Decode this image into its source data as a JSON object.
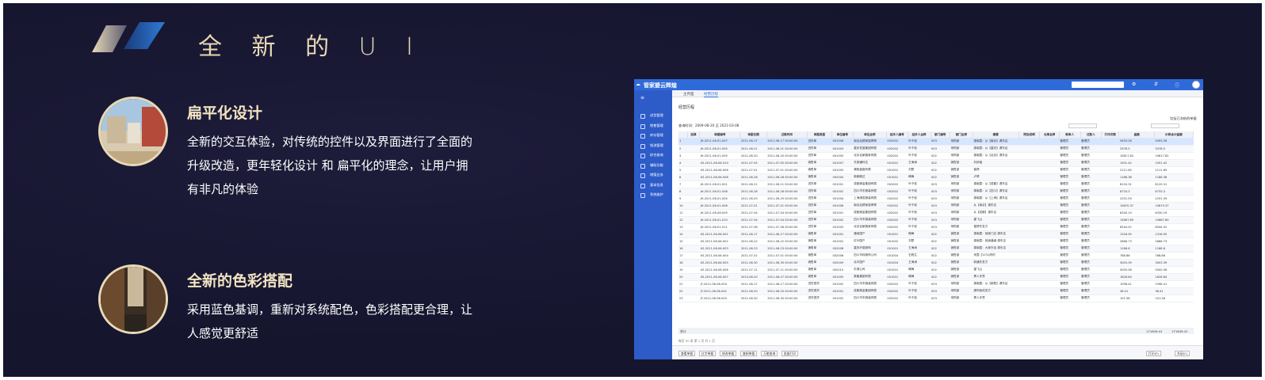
{
  "slide": {
    "title": "全 新 的 U I"
  },
  "features": [
    {
      "title": "扁平化设计",
      "desc": "全新的交互体验，对传统的控件以及界面进行了全面的升级改造，更年轻化设计 和 扁平化的理念，让用户拥有非凡的体验"
    },
    {
      "title": "全新的色彩搭配",
      "desc": "采用蓝色基调，重新对系统配色，色彩搭配更合理，让人感觉更舒适"
    }
  ],
  "app": {
    "brand": "管家婆云辉煌",
    "sidebar": [
      "进货管理",
      "销售管理",
      "库存管理",
      "钱流管理",
      "综合查询",
      "辅助功能",
      "增值业务",
      "基本信息",
      "系统维护"
    ],
    "tabs": [
      "主界面",
      "经营历程"
    ],
    "page_title": "经营历程",
    "filter_label": "查询时间：2009-08-20 至 2021-03-08",
    "check_label": "包括已冻结的单据",
    "columns": [
      "",
      "选择",
      "单据编号",
      "单据日期",
      "过账时间",
      "单据类型",
      "单位编号",
      "单位全称",
      "经手人编号",
      "经手人全称",
      "部门编号",
      "部门全称",
      "摘要",
      "附加说明",
      "仓库全称",
      "制单人",
      "过账人",
      "打印次数",
      "金额",
      "价税合计金额"
    ],
    "rows": [
      [
        "1",
        "",
        "JH-2011-06-01-007",
        "2011-06-17",
        "2011-06-17 00:00:00",
        "进货单",
        "001006",
        "南京后顾家族哥哥",
        "002002",
        "叶子叔",
        "003",
        "采购部",
        "源南霞：从【南京】源东店",
        "",
        "",
        "管理员",
        "管理员",
        "",
        "5493.28",
        "5493.28"
      ],
      [
        "2",
        "",
        "JH-2011-06-01-005",
        "2011-06-21",
        "2011-06-21 00:00:00",
        "进货单",
        "001003",
        "重庆发蓝集团有限",
        "002002",
        "叶子叔",
        "003",
        "采购部",
        "源南霞：从【重庆】源东店",
        "",
        "",
        "管理员",
        "管理员",
        "",
        "3378.5",
        "3378.5"
      ],
      [
        "3",
        "",
        "JH-2011-06-01-005",
        "2011-06-20",
        "2011-06-20 00:00:00",
        "进货单",
        "001005",
        "北京百家路家有限",
        "002002",
        "叶子叔",
        "002",
        "采购部",
        "源南霞：从【北京】源东店",
        "",
        "",
        "管理员",
        "管理员",
        "",
        "10817.82",
        "10817.82"
      ],
      [
        "4",
        "",
        "XS-2011-06-06-010",
        "2011-07-05",
        "2011-07-05 00:00:00",
        "销售单",
        "001007",
        "东莞通利达",
        "001001",
        "王海涛",
        "002",
        "销售部",
        "刘伊涵",
        "",
        "",
        "管理员",
        "管理员",
        "",
        "1551.42",
        "1551.42"
      ],
      [
        "5",
        "",
        "XS-2011-06-06-006",
        "2011-07-01",
        "2011-07-01 00:00:00",
        "销售单",
        "001005",
        "满阳鑫鑫有限",
        "001002",
        "刘蒙",
        "002",
        "销售部",
        "曾婷",
        "",
        "",
        "管理员",
        "管理员",
        "",
        "2111.65",
        "2111.65"
      ],
      [
        "6",
        "",
        "XS-2011-06-06-008",
        "2011-06-28",
        "2011-06-28 00:00:00",
        "销售单",
        "002004",
        "新都朗达",
        "001001",
        "韩梅",
        "002",
        "销售部",
        "卢琴",
        "",
        "",
        "管理员",
        "管理员",
        "",
        "1186.38",
        "1186.38"
      ],
      [
        "7",
        "",
        "JH-2011-06-01-001",
        "2011-06-21",
        "2011-06-21 00:00:00",
        "进货单",
        "001001",
        "成都美金集团有限",
        "002002",
        "叶子叔",
        "003",
        "采购部",
        "源南霞：从【成都】源东店",
        "",
        "",
        "管理员",
        "管理员",
        "",
        "8120.31",
        "8120.31"
      ],
      [
        "8",
        "",
        "JH-2011-06-01-008",
        "2011-06-28",
        "2011-06-28 00:00:00",
        "进货单",
        "001002",
        "四川华东服装有限",
        "002002",
        "叶子叔",
        "003",
        "采购部",
        "源南霞：从【四川】源东店",
        "",
        "",
        "管理员",
        "管理员",
        "",
        "8733.3",
        "8733.3"
      ],
      [
        "9",
        "",
        "JH-2011-06-01-004",
        "2011-06-29",
        "2011-06-29 00:00:00",
        "进货单",
        "001004",
        "上海浦发服装有限",
        "002002",
        "叶子叔",
        "003",
        "采购部",
        "源南霞：从【上海】源东店",
        "",
        "",
        "管理员",
        "管理员",
        "",
        "2251.59",
        "2251.59"
      ],
      [
        "10",
        "",
        "JH-2011-06-01-006",
        "2011-07-01",
        "2011-07-01 00:00:00",
        "进货单",
        "001006",
        "南京后顾家族哥哥",
        "002002",
        "叶子叔",
        "003",
        "采购部",
        "从【南京】源东店",
        "",
        "",
        "管理员",
        "管理员",
        "",
        "10870.37",
        "10870.37"
      ],
      [
        "11",
        "",
        "JH-2011-06-06-009",
        "2011-07-04",
        "2011-07-04 00:00:00",
        "进货单",
        "001001",
        "成都美金集团有限",
        "002002",
        "叶子叔",
        "003",
        "采购部",
        "从【成都】源东店",
        "",
        "",
        "管理员",
        "管理员",
        "",
        "6330.19",
        "6330.19"
      ],
      [
        "12",
        "",
        "JH-2011-06-01-010",
        "2011-07-04",
        "2011-07-04 00:00:00",
        "进货单",
        "001002",
        "四川华东服装有限",
        "002002",
        "叶子叔",
        "003",
        "采购部",
        "重飞山",
        "",
        "",
        "管理员",
        "管理员",
        "",
        "15667.89",
        "15667.89"
      ],
      [
        "13",
        "",
        "JH-2011-06-01-011",
        "2011-07-06",
        "2011-07-06 00:00:00",
        "进货单",
        "001005",
        "北京百家路家有限",
        "002002",
        "叶子叔",
        "003",
        "采购部",
        "曾婷先发方",
        "",
        "",
        "管理员",
        "管理员",
        "",
        "8544.52",
        "8544.52"
      ],
      [
        "14",
        "",
        "XS-2011-06-06-001",
        "2011-06-17",
        "2011-06-17 00:00:00",
        "销售单",
        "001001",
        "通用国产",
        "001001",
        "韩梅",
        "002",
        "销售部",
        "源南霞：前面门店 源东店",
        "",
        "",
        "管理员",
        "管理员",
        "",
        "1316.95",
        "1316.95"
      ],
      [
        "15",
        "",
        "XS-2011-06-06-002",
        "2011-06-22",
        "2011-06-22 00:00:00",
        "销售单",
        "001002",
        "红叶国产",
        "001002",
        "刘蒙",
        "002",
        "销售部",
        "源南霞：前面通道 源东店",
        "",
        "",
        "管理员",
        "管理员",
        "",
        "2866.73",
        "2866.73"
      ],
      [
        "16",
        "",
        "XS-2011-06-06-003",
        "2011-06-23",
        "2011-06-23 00:00:00",
        "销售单",
        "002008",
        "重庆环夏服饰",
        "001001",
        "王海涛",
        "002",
        "销售部",
        "源南霞：大家外加 源东店",
        "",
        "",
        "管理员",
        "管理员",
        "",
        "1186.6",
        "1186.6"
      ],
      [
        "17",
        "",
        "XS-2011-06-06-004",
        "2011-07-01",
        "2011-07-01 00:00:00",
        "销售单",
        "002008",
        "四川华科服饰公司",
        "001004",
        "石现生",
        "002",
        "销售部",
        "来霞【12%)同时",
        "",
        "",
        "管理员",
        "管理员",
        "",
        "768.86",
        "768.86"
      ],
      [
        "18",
        "",
        "XS-2011-06-06-005",
        "2011-06-30",
        "2011-06-30 00:00:00",
        "销售单",
        "002009",
        "北中国产",
        "001004",
        "王海涛",
        "002",
        "销售部",
        "新通先发方",
        "",
        "",
        "管理员",
        "管理员",
        "",
        "3003.39",
        "3003.39"
      ],
      [
        "19",
        "",
        "XS-2011-06-06-006",
        "2011-07-11",
        "2011-07-11 00:00:00",
        "销售单",
        "002010",
        "史源公司",
        "001001",
        "韩梅",
        "002",
        "销售部",
        "重飞山",
        "",
        "",
        "管理员",
        "管理员",
        "",
        "5000.58",
        "5000.58"
      ],
      [
        "20",
        "",
        "XS-2011-06-06-007",
        "2013-08-20",
        "2011-06-27 00:00:00",
        "销售单",
        "001005",
        "泉聚集团有限",
        "001001",
        "韩梅",
        "002",
        "销售部",
        "黑人牙膏",
        "",
        "",
        "管理员",
        "管理员",
        "",
        "1628.64",
        "1628.64"
      ],
      [
        "21",
        "",
        "JT-2011-06-06-004",
        "2011-06-17",
        "2011-06-17 00:00:00",
        "进货退货",
        "001002",
        "四川华东服装有限",
        "002002",
        "叶子叔",
        "003",
        "采购部",
        "源南霞：从【销售】源东店",
        "",
        "",
        "管理员",
        "管理员",
        "",
        "1998.41",
        "1998.41"
      ],
      [
        "22",
        "",
        "JT-2011-06-06-002",
        "2011-06-20",
        "2011-06-20 00:00:00",
        "进货退货",
        "001001",
        "成都美金集团有限",
        "002002",
        "叶子叔",
        "003",
        "采购部",
        "源同地改发方",
        "",
        "",
        "管理员",
        "管理员",
        "",
        "36.41",
        "36.41"
      ],
      [
        "23",
        "",
        "JT-2011-06-06-003",
        "2011-06-30",
        "2011-06-30 00:00:00",
        "进货退货",
        "001002",
        "四川华东服装有限",
        "002002",
        "叶子叔",
        "003",
        "采购部",
        "黑人牙膏",
        "",
        "",
        "管理员",
        "管理员",
        "",
        "101.58",
        "101.58"
      ]
    ],
    "total_label": "合计",
    "total_a": "171649.41",
    "total_b": "171649.41",
    "pager": "每页 50 条   第 1 页 共 1 页",
    "bottom_buttons": [
      "查看单据",
      "红字单据",
      "修改单据",
      "复制单据",
      "万能查询",
      "批量打印"
    ],
    "right_buttons": [
      "打印(P)",
      "关闭(C)"
    ]
  }
}
